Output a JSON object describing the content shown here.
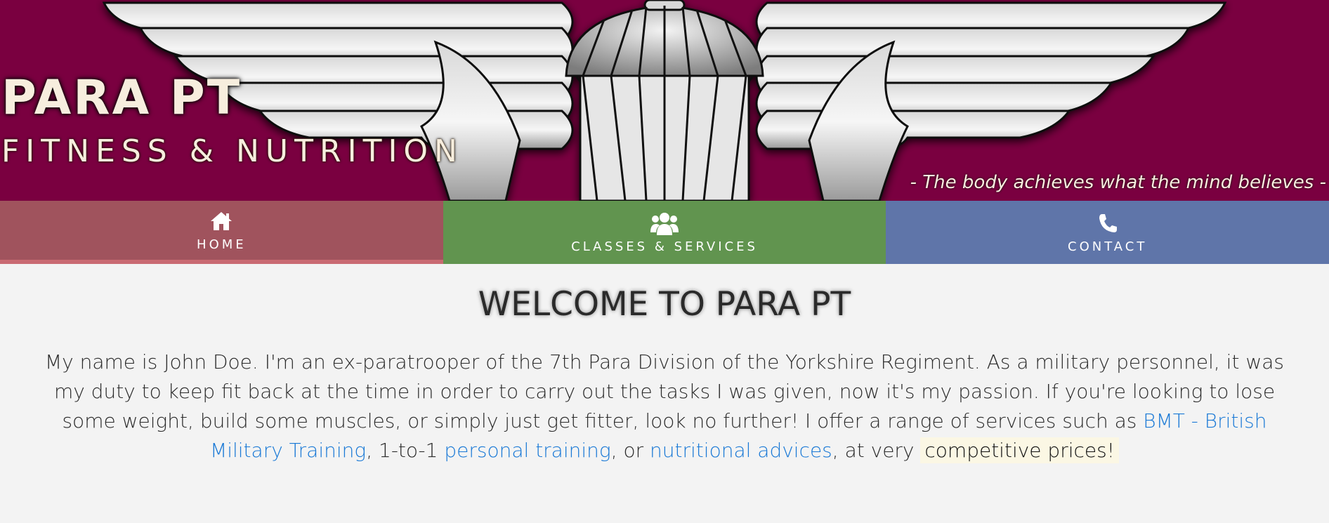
{
  "header": {
    "title": "PARA PT",
    "subtitle": "FITNESS & NUTRITION",
    "tagline": "- The body achieves what the mind believes -",
    "emblem_icon": "parachute-wings-emblem"
  },
  "nav": {
    "items": [
      {
        "label": "HOME",
        "icon": "home-icon"
      },
      {
        "label": "CLASSES & SERVICES",
        "icon": "users-icon"
      },
      {
        "label": "CONTACT",
        "icon": "phone-icon"
      }
    ]
  },
  "main": {
    "heading": "WELCOME TO PARA PT",
    "intro_text_1": "My name is John Doe. I'm an ex-paratrooper of the 7th Para Division of the Yorkshire Regiment. As a military personnel, it was my duty to keep fit back at the time in order to carry out the tasks I was given, now it's my passion. If you're looking to lose some weight, build some muscles, or simply just get fitter, look no further! I offer a range of services such as ",
    "link_bmt": "BMT - British Military Training",
    "intro_text_2": ", 1-to-1 ",
    "link_personal": "personal training",
    "intro_text_3": ", or ",
    "link_nutrition": "nutritional advices",
    "intro_text_4": ", at very ",
    "highlight": "competitive prices!"
  },
  "colors": {
    "hero_bg": "#7a0040",
    "home_bg": "#a0535d",
    "classes_bg": "#61944f",
    "contact_bg": "#5f75a9",
    "link": "#1a79d6",
    "page_bg": "#f3f3f3"
  }
}
